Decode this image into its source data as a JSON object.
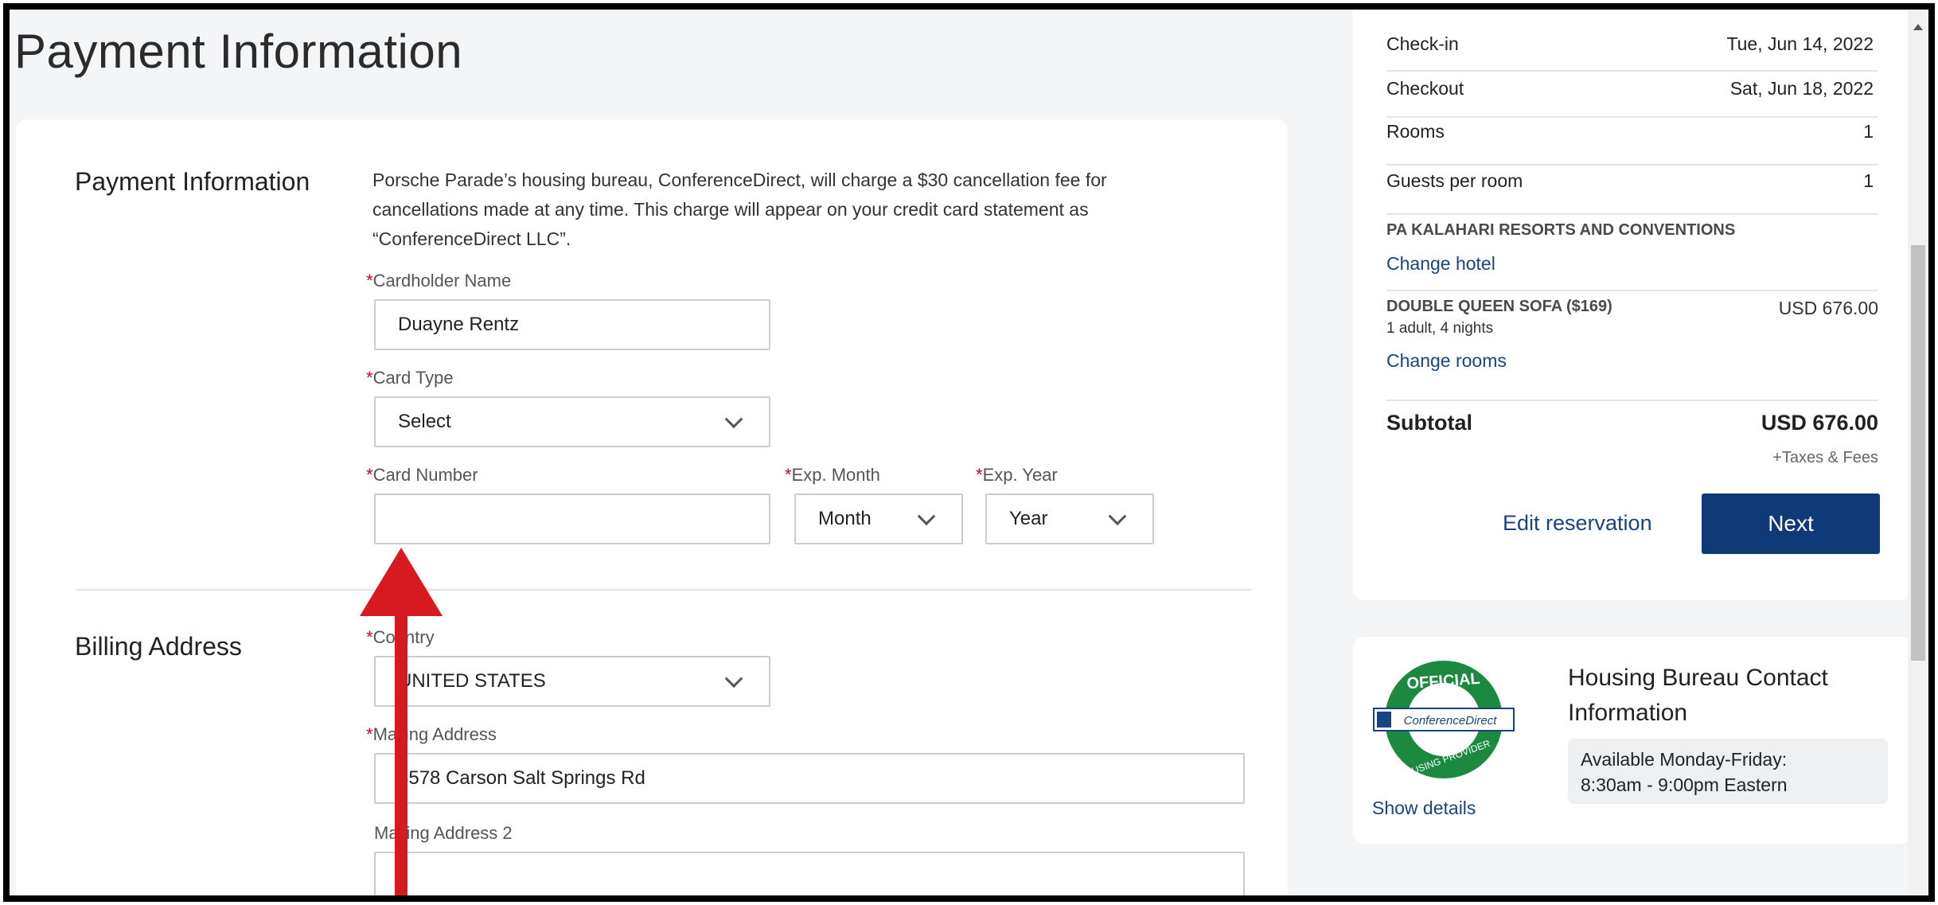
{
  "page": {
    "title": "Payment Information"
  },
  "payment": {
    "section_label": "Payment Information",
    "note": "Porsche Parade’s housing bureau, ConferenceDirect, will charge a $30 cancellation fee for cancellations made at any time. This charge will appear on your credit card statement as “ConferenceDirect LLC”.",
    "cardholder_label": "Cardholder Name",
    "cardholder_value": "Duayne Rentz",
    "card_type_label": "Card Type",
    "card_type_value": "Select",
    "card_number_label": "Card Number",
    "card_number_value": "",
    "exp_month_label": "Exp. Month",
    "exp_month_value": "Month",
    "exp_year_label": "Exp. Year",
    "exp_year_value": "Year",
    "required_marker": "*"
  },
  "billing": {
    "section_label": "Billing Address",
    "country_label": "Country",
    "country_value": "UNITED STATES",
    "mailing_label": "Mailing Address",
    "mailing_value": "5578 Carson Salt Springs Rd",
    "mailing2_label": "Mailing Address 2",
    "mailing2_value": ""
  },
  "summary": {
    "checkin_label": "Check-in",
    "checkin_value": "Tue, Jun 14, 2022",
    "checkout_label": "Checkout",
    "checkout_value": "Sat, Jun 18, 2022",
    "rooms_label": "Rooms",
    "rooms_value": "1",
    "guests_label": "Guests per room",
    "guests_value": "1",
    "hotel_name": "PA KALAHARI RESORTS AND CONVENTIONS",
    "change_hotel": "Change hotel",
    "room_name": "DOUBLE QUEEN SOFA ($169)",
    "room_sub": "1 adult, 4 nights",
    "room_price": "USD 676.00",
    "change_rooms": "Change rooms",
    "subtotal_label": "Subtotal",
    "subtotal_value": "USD 676.00",
    "taxes_note": "+Taxes & Fees",
    "edit_reservation": "Edit reservation",
    "next_button": "Next"
  },
  "contact": {
    "title": "Housing Bureau Contact Information",
    "hours_line1": "Available Monday-Friday:",
    "hours_line2": "8:30am - 9:00pm Eastern",
    "show_details": "Show details",
    "seal_top": "OFFICIAL",
    "seal_brand": "ConferenceDirect",
    "seal_bottom": "HOUSING PROVIDER"
  },
  "colors": {
    "accent": "#0e3a78",
    "link": "#1a4480",
    "required": "#d0021b",
    "annotation_arrow": "#d71920",
    "seal_green": "#1b8a3e"
  }
}
